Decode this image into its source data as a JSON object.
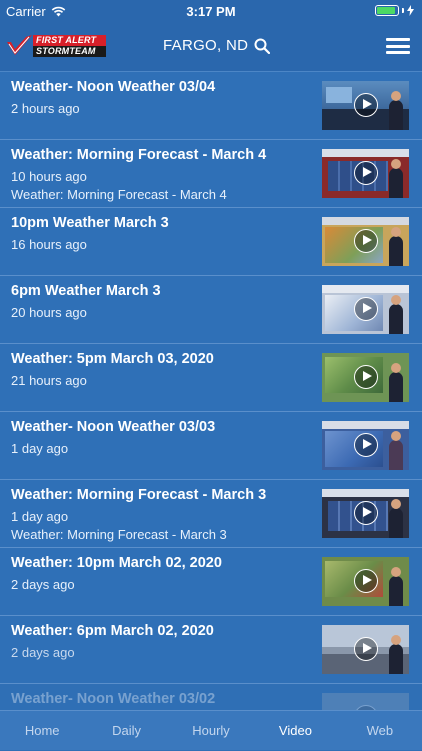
{
  "status_bar": {
    "carrier": "Carrier",
    "time": "3:17 PM",
    "battery_level": 0.9
  },
  "header": {
    "logo_text_1": "FIRST ALERT",
    "logo_text_2": "STORMTEAM",
    "city": "FARGO, ND"
  },
  "videos": [
    {
      "title": "Weather- Noon Weather 03/04",
      "time": "2 hours ago",
      "subtitle": ""
    },
    {
      "title": "Weather: Morning Forecast - March 4",
      "time": "10 hours ago",
      "subtitle": "Weather: Morning Forecast - March 4"
    },
    {
      "title": "10pm Weather March 3",
      "time": "16 hours ago",
      "subtitle": ""
    },
    {
      "title": "6pm Weather March 3",
      "time": "20 hours ago",
      "subtitle": ""
    },
    {
      "title": "Weather: 5pm March 03, 2020",
      "time": "21 hours ago",
      "subtitle": ""
    },
    {
      "title": "Weather- Noon Weather 03/03",
      "time": "1 day ago",
      "subtitle": ""
    },
    {
      "title": "Weather: Morning Forecast - March 3",
      "time": "1 day ago",
      "subtitle": "Weather: Morning Forecast - March 3"
    },
    {
      "title": "Weather: 10pm March 02, 2020",
      "time": "2 days ago",
      "subtitle": ""
    },
    {
      "title": "Weather: 6pm March 02, 2020",
      "time": "2 days ago",
      "subtitle": ""
    },
    {
      "title": "Weather- Noon Weather 03/02",
      "time": "",
      "subtitle": ""
    }
  ],
  "tabs": [
    {
      "label": "Home"
    },
    {
      "label": "Daily"
    },
    {
      "label": "Hourly"
    },
    {
      "label": "Video"
    },
    {
      "label": "Web"
    }
  ],
  "active_tab": "Video",
  "colors": {
    "background": "#2f70b7",
    "header": "#2a67ad",
    "tab_bar": "#3a78bd",
    "battery": "#4cd964",
    "logo_red": "#d7202a"
  }
}
